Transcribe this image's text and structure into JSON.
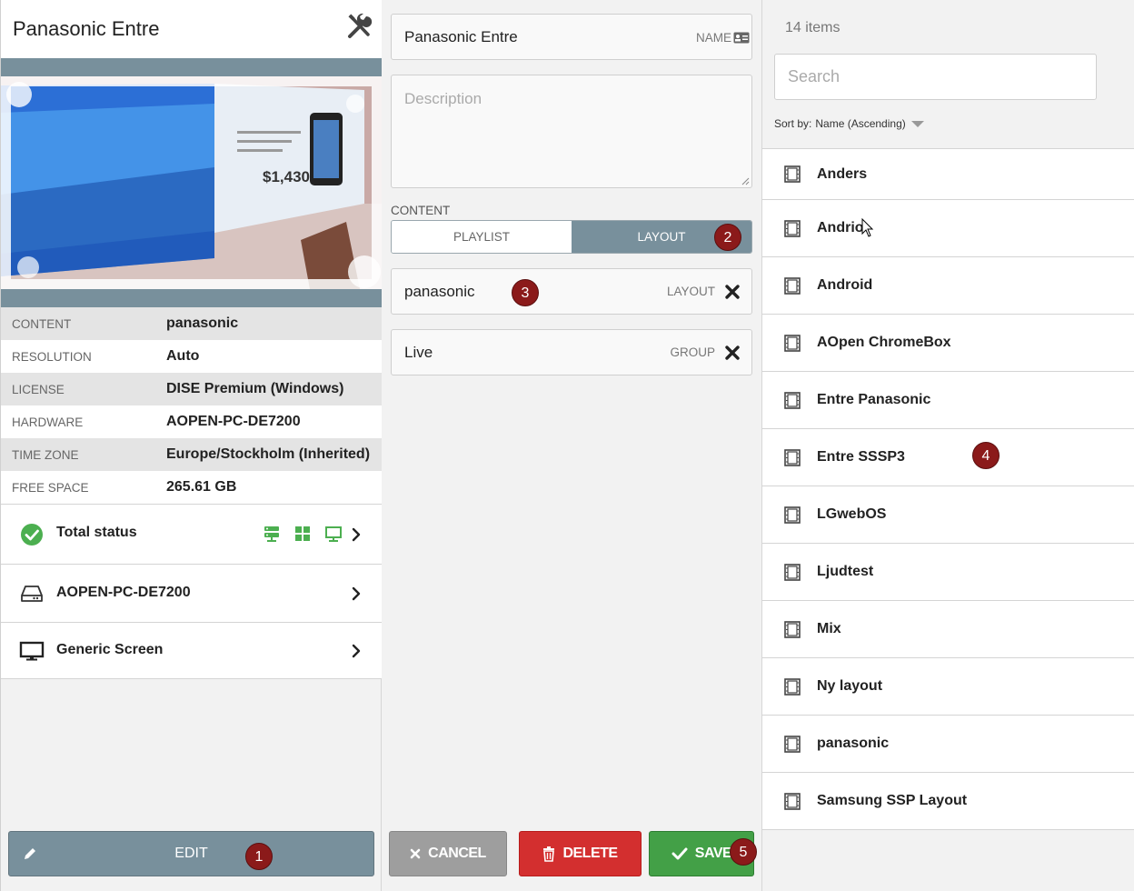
{
  "left": {
    "title": "Panasonic Entre",
    "info": [
      {
        "key": "CONTENT",
        "value": "panasonic"
      },
      {
        "key": "RESOLUTION",
        "value": "Auto"
      },
      {
        "key": "LICENSE",
        "value": "DISE Premium (Windows)"
      },
      {
        "key": "HARDWARE",
        "value": "AOPEN-PC-DE7200"
      },
      {
        "key": "TIME ZONE",
        "value": "Europe/Stockholm (Inherited)"
      },
      {
        "key": "FREE SPACE",
        "value": "265.61 GB"
      }
    ],
    "preview": {
      "price": "$1,430"
    },
    "total_status": "Total status",
    "hardware_row": "AOPEN-PC-DE7200",
    "screen_row": "Generic Screen",
    "edit_label": "EDIT"
  },
  "middle": {
    "name_value": "Panasonic Entre",
    "name_tag": "NAME",
    "description_placeholder": "Description",
    "content_label": "CONTENT",
    "tabs": {
      "playlist": "PLAYLIST",
      "layout": "LAYOUT"
    },
    "layout_value": "panasonic",
    "layout_tag": "LAYOUT",
    "group_value": "Live",
    "group_tag": "GROUP",
    "cancel_label": "CANCEL",
    "delete_label": "DELETE",
    "save_label": "SAVE"
  },
  "right": {
    "count": "14 items",
    "search_placeholder": "Search",
    "sort_label": "Sort by:",
    "sort_value": "Name (Ascending)",
    "items": [
      "Anders",
      "Andrio",
      "Android",
      "AOpen ChromeBox",
      "Entre Panasonic",
      "Entre SSSP3",
      "LGwebOS",
      "Ljudtest",
      "Mix",
      "Ny layout",
      "panasonic",
      "Samsung SSP Layout"
    ]
  },
  "badges": {
    "b1": "1",
    "b2": "2",
    "b3": "3",
    "b4": "4",
    "b5": "5"
  },
  "colors": {
    "slate": "#78909c",
    "danger": "#d32f2f",
    "success": "#43a047",
    "badge": "#8b1a1a",
    "status_green": "#4caf50"
  }
}
